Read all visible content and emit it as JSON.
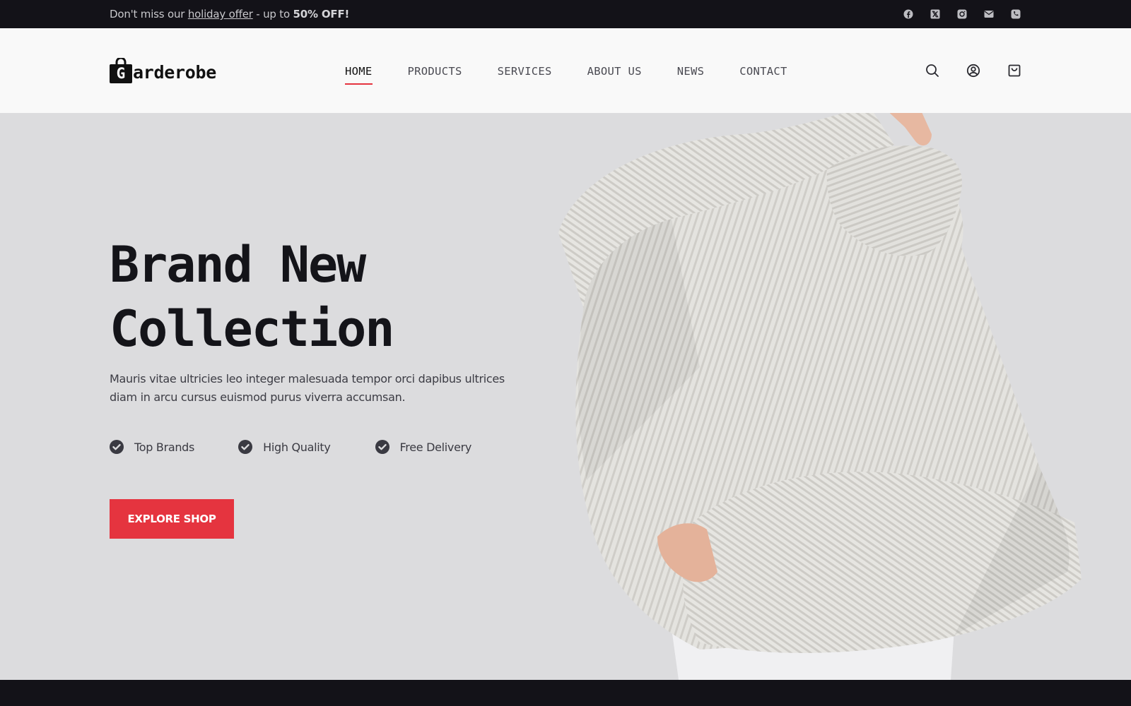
{
  "topbar": {
    "promo_prefix": "Don't miss our ",
    "promo_link": "holiday offer",
    "promo_middle": " - up to ",
    "promo_strong": "50% OFF!",
    "social_icons": [
      "facebook-icon",
      "x-twitter-icon",
      "instagram-icon",
      "mail-icon",
      "phone-icon"
    ]
  },
  "header": {
    "logo_letter": "G",
    "logo_text": "arderobe",
    "nav": [
      {
        "label": "HOME",
        "active": true
      },
      {
        "label": "PRODUCTS",
        "active": false
      },
      {
        "label": "SERVICES",
        "active": false
      },
      {
        "label": "ABOUT US",
        "active": false
      },
      {
        "label": "NEWS",
        "active": false
      },
      {
        "label": "CONTACT",
        "active": false
      }
    ],
    "tool_icons": [
      "search-icon",
      "user-account-icon",
      "shopping-bag-icon"
    ]
  },
  "hero": {
    "title_line1": "Brand New",
    "title_line2": "Collection",
    "description": "Mauris vitae ultricies leo integer malesuada tempor orci dapibus ultrices diam in arcu cursus euismod purus viverra accumsan.",
    "features": [
      "Top Brands",
      "High Quality",
      "Free Delivery"
    ],
    "cta_label": "EXPLORE SHOP"
  },
  "colors": {
    "accent": "#e5343f",
    "dark": "#131218",
    "hero_bg": "#dcdcde",
    "header_bg": "#f9f9f9"
  }
}
